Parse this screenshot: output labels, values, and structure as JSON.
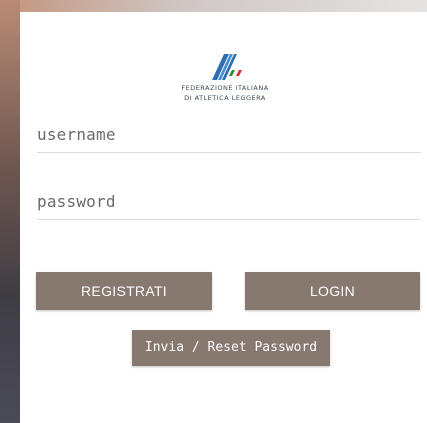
{
  "logo": {
    "line1": "FEDERAZIONE ITALIANA",
    "line2": "DI ATLETICA LEGGERA",
    "icon": "fidal-logo-icon"
  },
  "form": {
    "username_placeholder": "username",
    "password_placeholder": "password"
  },
  "buttons": {
    "register_label": "REGISTRATI",
    "login_label": "LOGIN",
    "reset_label": "Invia / Reset Password"
  },
  "colors": {
    "button_bg": "#877970",
    "button_text": "#ffffff",
    "logo_blue": "#2f6fb0",
    "logo_green": "#2e8b3a",
    "logo_red": "#d62828"
  }
}
